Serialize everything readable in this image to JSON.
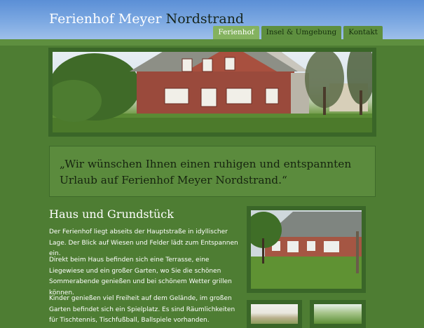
{
  "header": {
    "title_main": "Ferienhof Meyer",
    "title_accent": "Nordstrand"
  },
  "nav": [
    {
      "label": "Ferienhof",
      "active": true
    },
    {
      "label": "Insel & Umgebung",
      "active": false
    },
    {
      "label": "Kontakt",
      "active": false
    }
  ],
  "quote": "„Wir wünschen Ihnen einen ruhigen und entspannten Urlaub auf Ferienhof Meyer Nordstrand.“",
  "section": {
    "title": "Haus und Grundstück",
    "paragraphs": [
      "Der Ferienhof liegt abseits der Hauptstraße in idyllischer Lage. Der Blick auf Wiesen und Felder lädt zum Entspannen ein.",
      "Direkt beim Haus befinden sich eine Terrasse, eine Liegewiese und ein großer Garten, wo Sie die schönen Sommerabende genießen und bei schönem Wetter grillen können.",
      "Kinder genießen viel Freiheit auf dem Gelände, im großen Garten befindet sich ein Spielplatz. Es sind Räumlichkeiten für Tischtennis, Tischfußball, Ballspiele vorhanden."
    ]
  },
  "colors": {
    "background": "#4e7d33",
    "nav_active": "#84b25f",
    "nav_inactive": "#5e8f3f",
    "frame": "#3a6628"
  }
}
